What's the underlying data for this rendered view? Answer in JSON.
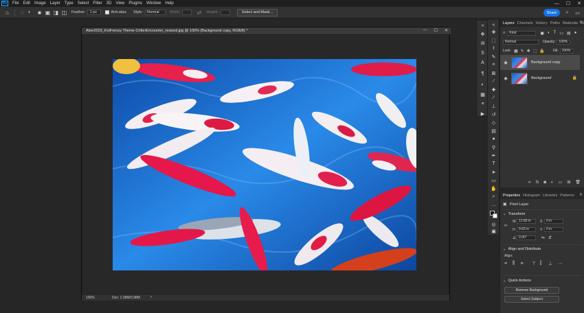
{
  "app": {
    "logo": "Ps",
    "accent": "#31a8ff"
  },
  "menu": [
    "File",
    "Edit",
    "Image",
    "Layer",
    "Type",
    "Select",
    "Filter",
    "3D",
    "View",
    "Plugins",
    "Window",
    "Help"
  ],
  "window_controls": {
    "minimize": "—",
    "maximize": "☐",
    "close": "✕"
  },
  "options_bar": {
    "feather_label": "Feather:",
    "feather_value": "1 px",
    "antialias_label": "Anti-alias",
    "style_label": "Style:",
    "style_value": "Normal",
    "width_label": "Width:",
    "height_label": "Height:",
    "select_mask_label": "Select and Mask..."
  },
  "share_label": "Share",
  "document": {
    "title": "Aber2023_KoiFrenzy-Theme-CritterEncounter_resized.jpg @ 100% (Background copy, RGB/8) *",
    "zoom": "100%",
    "doc_info": "Doc: 1.39M/3.98M",
    "image_description_icon": "koi-photo"
  },
  "layers_panel": {
    "tabs": [
      "Layers",
      "Channels",
      "History",
      "Paths",
      "Materials",
      "3D"
    ],
    "kind_label": "Kind",
    "blend_mode": "Normal",
    "opacity_label": "Opacity:",
    "opacity_value": "100%",
    "lock_label": "Lock:",
    "fill_label": "Fill:",
    "fill_value": "100%",
    "layers": [
      {
        "name": "Background copy",
        "selected": true,
        "italic": false
      },
      {
        "name": "Background",
        "selected": false,
        "italic": true
      }
    ]
  },
  "properties_panel": {
    "tabs": [
      "Properties",
      "Histogram",
      "Libraries",
      "Patterns"
    ],
    "layer_type": "Pixel Layer",
    "transform_title": "Transform",
    "w_label": "W",
    "w_value": "13.89 in",
    "h_label": "H",
    "h_value": "9.65 in",
    "x_label": "X",
    "x_value": "0 in",
    "y_label": "Y",
    "y_value": "0 in",
    "angle_value": "0.00°",
    "align_title": "Align and Distribute",
    "align_label": "Align:",
    "quick_actions_title": "Quick Actions",
    "remove_bg_label": "Remove Background",
    "select_subject_label": "Select Subject"
  }
}
